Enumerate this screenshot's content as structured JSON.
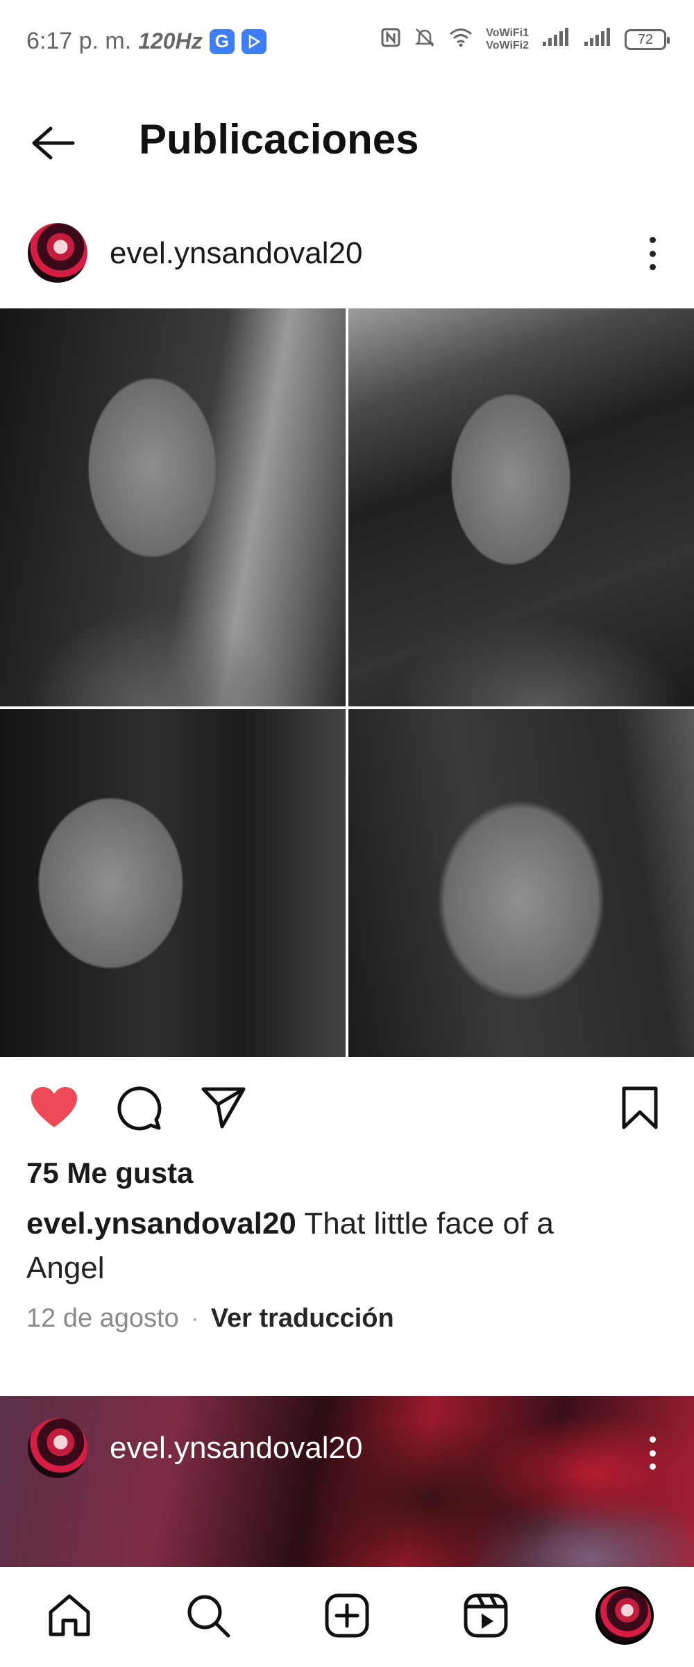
{
  "status_bar": {
    "time": "6:17 p. m.",
    "refresh_rate": "120Hz",
    "app_badge_1": "G",
    "wifi_label_1": "VoWiFi1",
    "wifi_label_2": "VoWiFi2",
    "battery": "72"
  },
  "header": {
    "title": "Publicaciones",
    "back_icon": "arrow-left-icon"
  },
  "post": {
    "username": "evel.ynsandoval20",
    "photo_count": 4,
    "likes": "75 Me gusta",
    "caption_user": "evel.ynsandoval20",
    "caption_text": "That little face of a Angel",
    "date": "12 de agosto",
    "meta_separator": "·",
    "translate": "Ver traducción",
    "liked": true,
    "like_color": "#ed4956"
  },
  "next_post": {
    "username": "evel.ynsandoval20"
  },
  "bottom_nav": {
    "items": [
      "home-icon",
      "search-icon",
      "create-icon",
      "reels-icon",
      "profile-avatar"
    ]
  }
}
